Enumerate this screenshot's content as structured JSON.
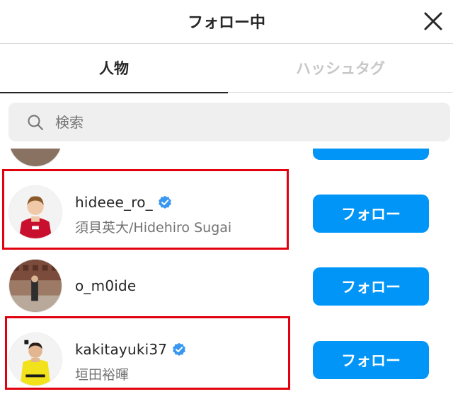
{
  "header": {
    "title": "フォロー中",
    "close_icon": "close-icon"
  },
  "tabs": [
    {
      "label": "人物",
      "active": true
    },
    {
      "label": "ハッシュタグ",
      "active": false
    }
  ],
  "search": {
    "placeholder": "検索",
    "icon": "search-icon"
  },
  "follow_button_label": "フォロー",
  "users": [
    {
      "username": "hideee_ro_",
      "full_name": "須貝英大/Hidehiro Sugai",
      "verified": true,
      "highlighted": true
    },
    {
      "username": "o_m0ide",
      "full_name": "",
      "verified": false,
      "highlighted": false
    },
    {
      "username": "kakitayuki37",
      "full_name": "垣田裕暉",
      "verified": true,
      "highlighted": true
    }
  ],
  "colors": {
    "accent": "#0095f6",
    "highlight": "#e0000e",
    "verified": "#3897f0",
    "inactive_tab": "#c7c7c7",
    "secondary_text": "#737373"
  }
}
